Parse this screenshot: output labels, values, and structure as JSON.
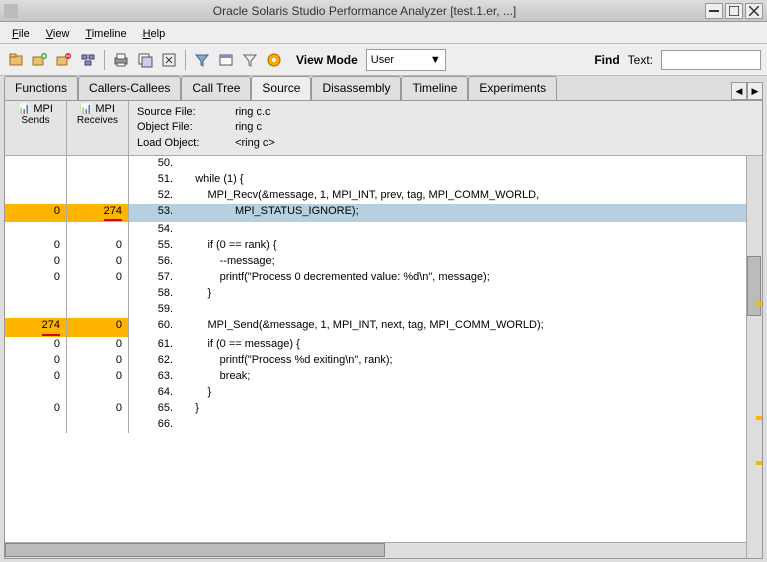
{
  "window": {
    "title": "Oracle Solaris Studio Performance Analyzer [test.1.er, ...]"
  },
  "menu": {
    "file": "File",
    "view": "View",
    "timeline": "Timeline",
    "help": "Help"
  },
  "toolbar": {
    "viewmode_label": "View Mode",
    "viewmode_value": "User",
    "find_label": "Find",
    "text_label": "Text:"
  },
  "tabs": {
    "items": [
      "Functions",
      "Callers-Callees",
      "Call Tree",
      "Source",
      "Disassembly",
      "Timeline",
      "Experiments"
    ],
    "active_index": 3
  },
  "headers": {
    "mpi_sends_icon_label": "MPI",
    "mpi_sends": "Sends",
    "mpi_receives_icon_label": "MPI",
    "mpi_receives": "Receives",
    "source_file_label": "Source File:",
    "source_file": "ring c.c",
    "object_file_label": "Object File:",
    "object_file": "ring c",
    "load_object_label": "Load Object:",
    "load_object": "<ring c>"
  },
  "code_lines": [
    {
      "sends": "",
      "recvs": "",
      "num": "50.",
      "text": "",
      "sel": false,
      "hl_s": false,
      "hl_r": false,
      "u_s": false,
      "u_r": false
    },
    {
      "sends": "",
      "recvs": "",
      "num": "51.",
      "text": "    while (1) {",
      "sel": false,
      "hl_s": false,
      "hl_r": false,
      "u_s": false,
      "u_r": false
    },
    {
      "sends": "",
      "recvs": "",
      "num": "52.",
      "text": "        MPI_Recv(&message, 1, MPI_INT, prev, tag, MPI_COMM_WORLD,",
      "sel": false,
      "hl_s": false,
      "hl_r": false,
      "u_s": false,
      "u_r": false
    },
    {
      "sends": "0",
      "recvs": "274",
      "num": "53.",
      "text": "                 MPI_STATUS_IGNORE);",
      "sel": true,
      "hl_s": true,
      "hl_r": true,
      "u_s": false,
      "u_r": true
    },
    {
      "sends": "",
      "recvs": "",
      "num": "54.",
      "text": "",
      "sel": false,
      "hl_s": false,
      "hl_r": false,
      "u_s": false,
      "u_r": false
    },
    {
      "sends": "0",
      "recvs": "0",
      "num": "55.",
      "text": "        if (0 == rank) {",
      "sel": false,
      "hl_s": false,
      "hl_r": false,
      "u_s": false,
      "u_r": false
    },
    {
      "sends": "0",
      "recvs": "0",
      "num": "56.",
      "text": "            --message;",
      "sel": false,
      "hl_s": false,
      "hl_r": false,
      "u_s": false,
      "u_r": false
    },
    {
      "sends": "0",
      "recvs": "0",
      "num": "57.",
      "text": "            printf(\"Process 0 decremented value: %d\\n\", message);",
      "sel": false,
      "hl_s": false,
      "hl_r": false,
      "u_s": false,
      "u_r": false
    },
    {
      "sends": "",
      "recvs": "",
      "num": "58.",
      "text": "        }",
      "sel": false,
      "hl_s": false,
      "hl_r": false,
      "u_s": false,
      "u_r": false
    },
    {
      "sends": "",
      "recvs": "",
      "num": "59.",
      "text": "",
      "sel": false,
      "hl_s": false,
      "hl_r": false,
      "u_s": false,
      "u_r": false
    },
    {
      "sends": "274",
      "recvs": "0",
      "num": "60.",
      "text": "        MPI_Send(&message, 1, MPI_INT, next, tag, MPI_COMM_WORLD);",
      "sel": false,
      "hl_s": true,
      "hl_r": true,
      "u_s": true,
      "u_r": false
    },
    {
      "sends": "0",
      "recvs": "0",
      "num": "61.",
      "text": "        if (0 == message) {",
      "sel": false,
      "hl_s": false,
      "hl_r": false,
      "u_s": false,
      "u_r": false
    },
    {
      "sends": "0",
      "recvs": "0",
      "num": "62.",
      "text": "            printf(\"Process %d exiting\\n\", rank);",
      "sel": false,
      "hl_s": false,
      "hl_r": false,
      "u_s": false,
      "u_r": false
    },
    {
      "sends": "0",
      "recvs": "0",
      "num": "63.",
      "text": "            break;",
      "sel": false,
      "hl_s": false,
      "hl_r": false,
      "u_s": false,
      "u_r": false
    },
    {
      "sends": "",
      "recvs": "",
      "num": "64.",
      "text": "        }",
      "sel": false,
      "hl_s": false,
      "hl_r": false,
      "u_s": false,
      "u_r": false
    },
    {
      "sends": "0",
      "recvs": "0",
      "num": "65.",
      "text": "    }",
      "sel": false,
      "hl_s": false,
      "hl_r": false,
      "u_s": false,
      "u_r": false
    },
    {
      "sends": "",
      "recvs": "",
      "num": "66.",
      "text": "",
      "sel": false,
      "hl_s": false,
      "hl_r": false,
      "u_s": false,
      "u_r": false
    }
  ]
}
